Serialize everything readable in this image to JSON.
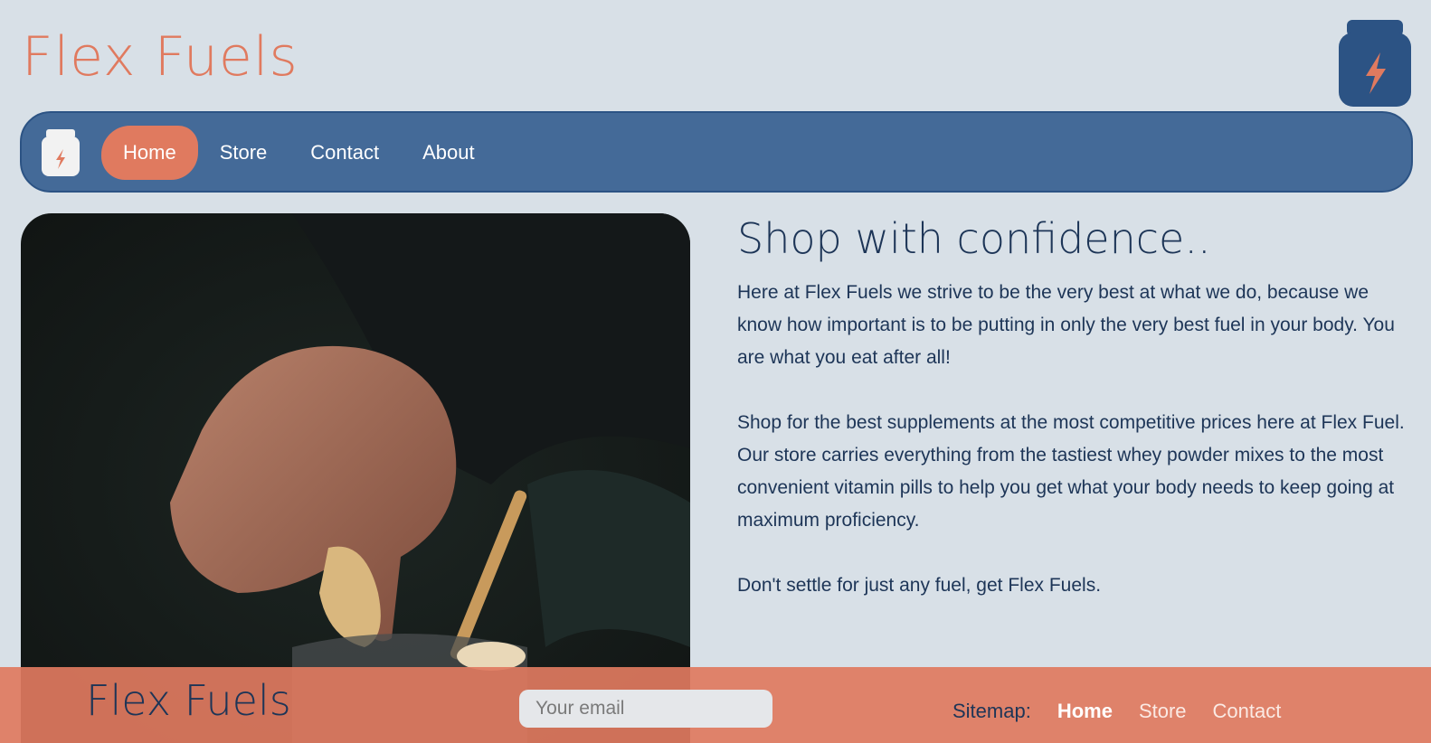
{
  "header": {
    "title": "Flex Fuels",
    "logo_icon": "supplement-jar-icon"
  },
  "nav": {
    "logo_icon": "supplement-jar-icon",
    "items": [
      {
        "label": "Home",
        "active": true
      },
      {
        "label": "Store",
        "active": false
      },
      {
        "label": "Contact",
        "active": false
      },
      {
        "label": "About",
        "active": false
      }
    ]
  },
  "hero": {
    "image": "hand dropping banana slice into a shake jar with bamboo straw"
  },
  "main": {
    "heading": "Shop with confidence..",
    "paragraphs": [
      "Here at Flex Fuels we strive to be the very best at what we do, because we know how important is to be putting in only the very best fuel in your body. You are what you eat after all!",
      "Shop for the best supplements at the most competitive prices here at Flex Fuel. Our store carries everything from the tastiest whey powder mixes to the most convenient vitamin pills to help you get what your body needs to keep going at maximum proficiency.",
      "Don't settle for just any fuel, get Flex Fuels."
    ]
  },
  "footer": {
    "title": "Flex Fuels",
    "email_placeholder": "Your email",
    "sitemap_label": "Sitemap:",
    "sitemap_links": [
      "Home",
      "Store",
      "Contact"
    ]
  },
  "colors": {
    "accent": "#e07a5f",
    "nav_blue": "#446a98",
    "dark_blue": "#1d3557",
    "background": "#d8e0e7"
  }
}
